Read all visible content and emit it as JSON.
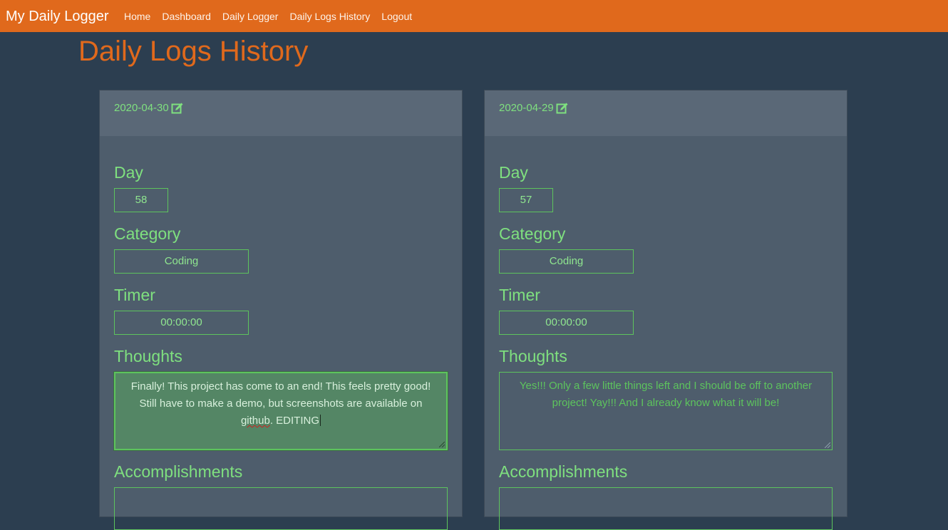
{
  "navbar": {
    "brand": "My Daily Logger",
    "links": [
      "Home",
      "Dashboard",
      "Daily Logger",
      "Daily Logs History",
      "Logout"
    ],
    "color": "#e0691c"
  },
  "page": {
    "title": "Daily Logs History"
  },
  "labels": {
    "day": "Day",
    "category": "Category",
    "timer": "Timer",
    "thoughts": "Thoughts",
    "accomplishments": "Accomplishments"
  },
  "logs": [
    {
      "date": "2020-04-30",
      "edit_icon": "edit-icon",
      "day": "58",
      "category": "Coding",
      "timer": "00:00:00",
      "thoughts_main": "Finally! This project has come to an end! This feels pretty good! Still have to make a demo, but screenshots are available on ",
      "thoughts_misspelled": "github",
      "thoughts_tail": ". EDITING",
      "editing": true
    },
    {
      "date": "2020-04-29",
      "edit_icon": "edit-icon",
      "day": "57",
      "category": "Coding",
      "timer": "00:00:00",
      "thoughts": "Yes!!! Only a few little things left and I should be off to another project! Yay!!! And I already know what it will be!",
      "editing": false
    }
  ],
  "colors": {
    "background": "#2c3e50",
    "card": "#4e5d6c",
    "card_header": "#5a6877",
    "accent_green": "#7fe07f",
    "title_orange": "#e0691c"
  }
}
